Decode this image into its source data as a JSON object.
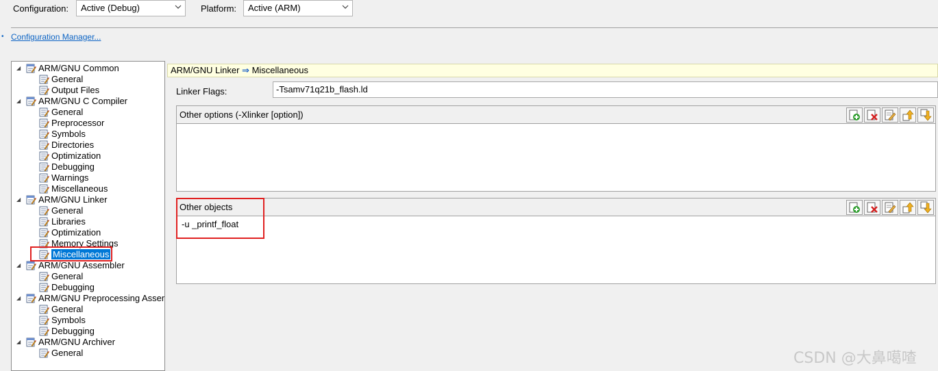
{
  "header": {
    "configuration_label": "Configuration:",
    "configuration_value": "Active (Debug)",
    "platform_label": "Platform:",
    "platform_value": "Active (ARM)",
    "config_manager_link": "Configuration Manager..."
  },
  "tree": {
    "groups": [
      {
        "label": "ARM/GNU Common",
        "children": [
          "General",
          "Output Files"
        ]
      },
      {
        "label": "ARM/GNU C Compiler",
        "children": [
          "General",
          "Preprocessor",
          "Symbols",
          "Directories",
          "Optimization",
          "Debugging",
          "Warnings",
          "Miscellaneous"
        ]
      },
      {
        "label": "ARM/GNU Linker",
        "children": [
          "General",
          "Libraries",
          "Optimization",
          "Memory Settings",
          "Miscellaneous"
        ]
      },
      {
        "label": "ARM/GNU Assembler",
        "children": [
          "General",
          "Debugging"
        ]
      },
      {
        "label": "ARM/GNU Preprocessing Assem",
        "children": [
          "General",
          "Symbols",
          "Debugging"
        ]
      },
      {
        "label": "ARM/GNU Archiver",
        "children": [
          "General"
        ]
      }
    ],
    "selected": "ARM/GNU Linker > Miscellaneous"
  },
  "breadcrumb": {
    "section": "ARM/GNU Linker",
    "arrow": "⇒",
    "page": "Miscellaneous"
  },
  "linker_flags": {
    "label": "Linker Flags:",
    "value": "-Tsamv71q21b_flash.ld"
  },
  "other_options": {
    "title": "Other options (-Xlinker [option])",
    "items": []
  },
  "other_objects": {
    "title": "Other objects",
    "items": [
      "-u _printf_float"
    ]
  },
  "toolbar_icons": [
    "add-item-icon",
    "delete-item-icon",
    "edit-item-icon",
    "move-up-icon",
    "move-down-icon"
  ],
  "watermark": "CSDN @大鼻噶喳",
  "colors": {
    "selection": "#0078d7",
    "highlight_box": "#e02020",
    "breadcrumb_bg": "#ffffe1",
    "link": "#0b63c4"
  }
}
